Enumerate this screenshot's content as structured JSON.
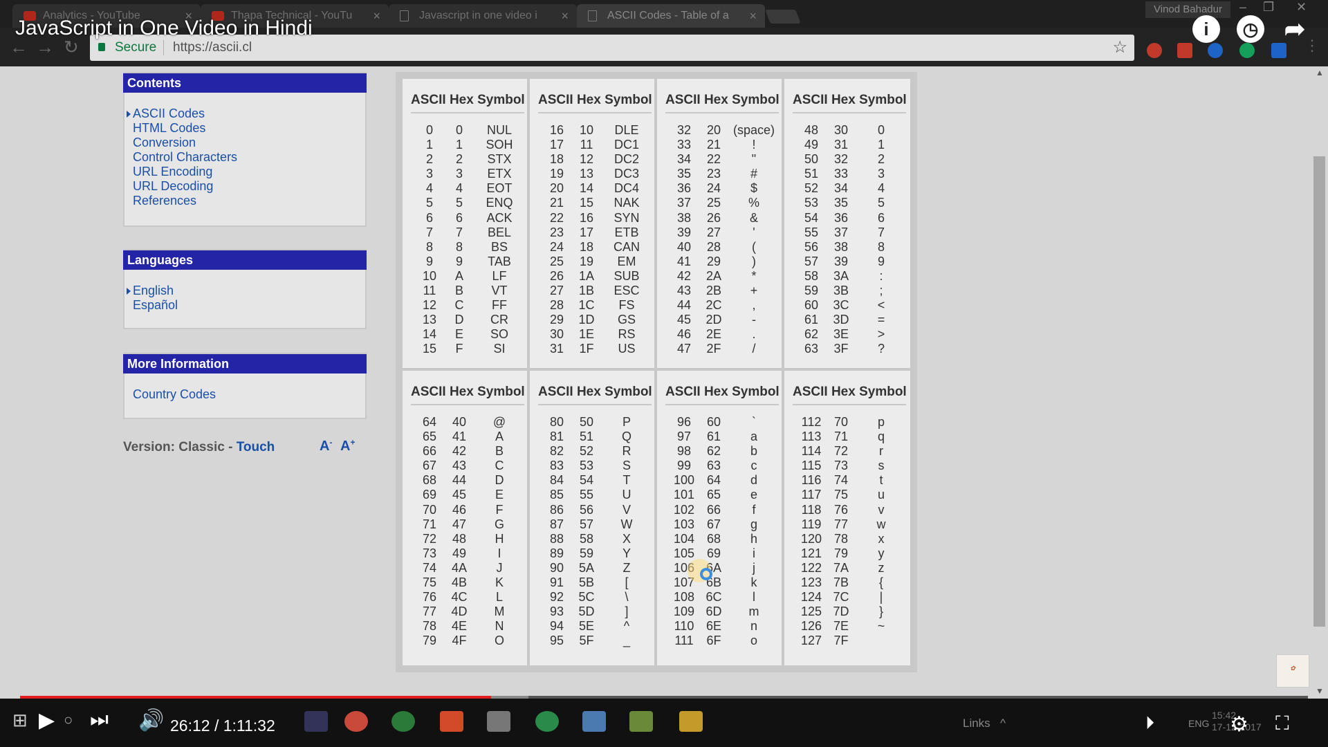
{
  "browser": {
    "tabs": [
      {
        "label": "Analytics - YouTube",
        "icon": "youtube-icon"
      },
      {
        "label": "Thapa Technical - YouTu",
        "icon": "youtube-icon"
      },
      {
        "label": "Javascript in one video i",
        "icon": "document-icon"
      },
      {
        "label": "ASCII Codes - Table of a",
        "icon": "document-icon"
      }
    ],
    "profile_name": "Vinod Bahadur",
    "secure_label": "Secure",
    "url": "https://ascii.cl"
  },
  "video": {
    "title": "JavaScript in One Video in Hindi",
    "current_time": "26:12",
    "duration": "1:11:32",
    "time_display": "26:12 / 1:11:32",
    "progress_fraction": 0.366,
    "buffered_fraction": 0.395
  },
  "sidebar": {
    "contents": {
      "title": "Contents",
      "items": [
        "ASCII Codes",
        "HTML Codes",
        "Conversion",
        "Control Characters",
        "URL Encoding",
        "URL Decoding",
        "References"
      ],
      "current": "ASCII Codes"
    },
    "languages": {
      "title": "Languages",
      "items": [
        "English",
        "Español"
      ],
      "current": "English"
    },
    "more_info": {
      "title": "More Information",
      "items": [
        "Country Codes"
      ]
    },
    "version_label": "Version: Classic",
    "version_separator": " - ",
    "version_link": "Touch",
    "font_decrease": "A",
    "font_decrease_sup": "-",
    "font_increase": "A",
    "font_increase_sup": "+"
  },
  "ascii_table": {
    "header": "ASCII Hex Symbol",
    "blocks": [
      [
        [
          "0",
          "0",
          "NUL"
        ],
        [
          "1",
          "1",
          "SOH"
        ],
        [
          "2",
          "2",
          "STX"
        ],
        [
          "3",
          "3",
          "ETX"
        ],
        [
          "4",
          "4",
          "EOT"
        ],
        [
          "5",
          "5",
          "ENQ"
        ],
        [
          "6",
          "6",
          "ACK"
        ],
        [
          "7",
          "7",
          "BEL"
        ],
        [
          "8",
          "8",
          "BS"
        ],
        [
          "9",
          "9",
          "TAB"
        ],
        [
          "10",
          "A",
          "LF"
        ],
        [
          "11",
          "B",
          "VT"
        ],
        [
          "12",
          "C",
          "FF"
        ],
        [
          "13",
          "D",
          "CR"
        ],
        [
          "14",
          "E",
          "SO"
        ],
        [
          "15",
          "F",
          "SI"
        ]
      ],
      [
        [
          "16",
          "10",
          "DLE"
        ],
        [
          "17",
          "11",
          "DC1"
        ],
        [
          "18",
          "12",
          "DC2"
        ],
        [
          "19",
          "13",
          "DC3"
        ],
        [
          "20",
          "14",
          "DC4"
        ],
        [
          "21",
          "15",
          "NAK"
        ],
        [
          "22",
          "16",
          "SYN"
        ],
        [
          "23",
          "17",
          "ETB"
        ],
        [
          "24",
          "18",
          "CAN"
        ],
        [
          "25",
          "19",
          "EM"
        ],
        [
          "26",
          "1A",
          "SUB"
        ],
        [
          "27",
          "1B",
          "ESC"
        ],
        [
          "28",
          "1C",
          "FS"
        ],
        [
          "29",
          "1D",
          "GS"
        ],
        [
          "30",
          "1E",
          "RS"
        ],
        [
          "31",
          "1F",
          "US"
        ]
      ],
      [
        [
          "32",
          "20",
          "(space)"
        ],
        [
          "33",
          "21",
          "!"
        ],
        [
          "34",
          "22",
          "\""
        ],
        [
          "35",
          "23",
          "#"
        ],
        [
          "36",
          "24",
          "$"
        ],
        [
          "37",
          "25",
          "%"
        ],
        [
          "38",
          "26",
          "&"
        ],
        [
          "39",
          "27",
          "'"
        ],
        [
          "40",
          "28",
          "("
        ],
        [
          "41",
          "29",
          ")"
        ],
        [
          "42",
          "2A",
          "*"
        ],
        [
          "43",
          "2B",
          "+"
        ],
        [
          "44",
          "2C",
          ","
        ],
        [
          "45",
          "2D",
          "-"
        ],
        [
          "46",
          "2E",
          "."
        ],
        [
          "47",
          "2F",
          "/"
        ]
      ],
      [
        [
          "48",
          "30",
          "0"
        ],
        [
          "49",
          "31",
          "1"
        ],
        [
          "50",
          "32",
          "2"
        ],
        [
          "51",
          "33",
          "3"
        ],
        [
          "52",
          "34",
          "4"
        ],
        [
          "53",
          "35",
          "5"
        ],
        [
          "54",
          "36",
          "6"
        ],
        [
          "55",
          "37",
          "7"
        ],
        [
          "56",
          "38",
          "8"
        ],
        [
          "57",
          "39",
          "9"
        ],
        [
          "58",
          "3A",
          ":"
        ],
        [
          "59",
          "3B",
          ";"
        ],
        [
          "60",
          "3C",
          "<"
        ],
        [
          "61",
          "3D",
          "="
        ],
        [
          "62",
          "3E",
          ">"
        ],
        [
          "63",
          "3F",
          "?"
        ]
      ],
      [
        [
          "64",
          "40",
          "@"
        ],
        [
          "65",
          "41",
          "A"
        ],
        [
          "66",
          "42",
          "B"
        ],
        [
          "67",
          "43",
          "C"
        ],
        [
          "68",
          "44",
          "D"
        ],
        [
          "69",
          "45",
          "E"
        ],
        [
          "70",
          "46",
          "F"
        ],
        [
          "71",
          "47",
          "G"
        ],
        [
          "72",
          "48",
          "H"
        ],
        [
          "73",
          "49",
          "I"
        ],
        [
          "74",
          "4A",
          "J"
        ],
        [
          "75",
          "4B",
          "K"
        ],
        [
          "76",
          "4C",
          "L"
        ],
        [
          "77",
          "4D",
          "M"
        ],
        [
          "78",
          "4E",
          "N"
        ],
        [
          "79",
          "4F",
          "O"
        ]
      ],
      [
        [
          "80",
          "50",
          "P"
        ],
        [
          "81",
          "51",
          "Q"
        ],
        [
          "82",
          "52",
          "R"
        ],
        [
          "83",
          "53",
          "S"
        ],
        [
          "84",
          "54",
          "T"
        ],
        [
          "85",
          "55",
          "U"
        ],
        [
          "86",
          "56",
          "V"
        ],
        [
          "87",
          "57",
          "W"
        ],
        [
          "88",
          "58",
          "X"
        ],
        [
          "89",
          "59",
          "Y"
        ],
        [
          "90",
          "5A",
          "Z"
        ],
        [
          "91",
          "5B",
          "["
        ],
        [
          "92",
          "5C",
          "\\"
        ],
        [
          "93",
          "5D",
          "]"
        ],
        [
          "94",
          "5E",
          "^"
        ],
        [
          "95",
          "5F",
          "_"
        ]
      ],
      [
        [
          "96",
          "60",
          "`"
        ],
        [
          "97",
          "61",
          "a"
        ],
        [
          "98",
          "62",
          "b"
        ],
        [
          "99",
          "63",
          "c"
        ],
        [
          "100",
          "64",
          "d"
        ],
        [
          "101",
          "65",
          "e"
        ],
        [
          "102",
          "66",
          "f"
        ],
        [
          "103",
          "67",
          "g"
        ],
        [
          "104",
          "68",
          "h"
        ],
        [
          "105",
          "69",
          "i"
        ],
        [
          "106",
          "6A",
          "j"
        ],
        [
          "107",
          "6B",
          "k"
        ],
        [
          "108",
          "6C",
          "l"
        ],
        [
          "109",
          "6D",
          "m"
        ],
        [
          "110",
          "6E",
          "n"
        ],
        [
          "111",
          "6F",
          "o"
        ]
      ],
      [
        [
          "112",
          "70",
          "p"
        ],
        [
          "113",
          "71",
          "q"
        ],
        [
          "114",
          "72",
          "r"
        ],
        [
          "115",
          "73",
          "s"
        ],
        [
          "116",
          "74",
          "t"
        ],
        [
          "117",
          "75",
          "u"
        ],
        [
          "118",
          "76",
          "v"
        ],
        [
          "119",
          "77",
          "w"
        ],
        [
          "120",
          "78",
          "x"
        ],
        [
          "121",
          "79",
          "y"
        ],
        [
          "122",
          "7A",
          "z"
        ],
        [
          "123",
          "7B",
          "{"
        ],
        [
          "124",
          "7C",
          "|"
        ],
        [
          "125",
          "7D",
          "}"
        ],
        [
          "126",
          "7E",
          "~"
        ],
        [
          "127",
          "7F",
          ""
        ]
      ]
    ]
  },
  "taskbar": {
    "links_label": "Links",
    "language": "ENG",
    "time": "15:42",
    "date": "17-12-2017"
  },
  "colors": {
    "sidebar_header": "#2424a6",
    "link": "#1a4fa8",
    "progress_played": "#e21d1d",
    "secure": "#0b8043"
  }
}
